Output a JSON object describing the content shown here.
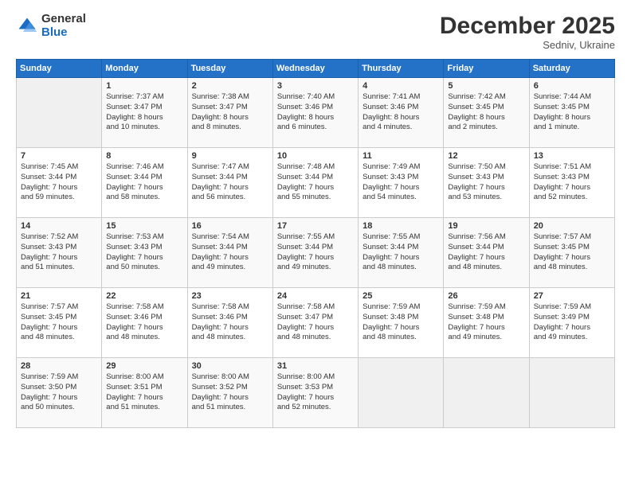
{
  "header": {
    "logo_general": "General",
    "logo_blue": "Blue",
    "month_title": "December 2025",
    "location": "Sedniv, Ukraine"
  },
  "weekdays": [
    "Sunday",
    "Monday",
    "Tuesday",
    "Wednesday",
    "Thursday",
    "Friday",
    "Saturday"
  ],
  "weeks": [
    [
      {
        "day": "",
        "info": ""
      },
      {
        "day": "1",
        "info": "Sunrise: 7:37 AM\nSunset: 3:47 PM\nDaylight: 8 hours\nand 10 minutes."
      },
      {
        "day": "2",
        "info": "Sunrise: 7:38 AM\nSunset: 3:47 PM\nDaylight: 8 hours\nand 8 minutes."
      },
      {
        "day": "3",
        "info": "Sunrise: 7:40 AM\nSunset: 3:46 PM\nDaylight: 8 hours\nand 6 minutes."
      },
      {
        "day": "4",
        "info": "Sunrise: 7:41 AM\nSunset: 3:46 PM\nDaylight: 8 hours\nand 4 minutes."
      },
      {
        "day": "5",
        "info": "Sunrise: 7:42 AM\nSunset: 3:45 PM\nDaylight: 8 hours\nand 2 minutes."
      },
      {
        "day": "6",
        "info": "Sunrise: 7:44 AM\nSunset: 3:45 PM\nDaylight: 8 hours\nand 1 minute."
      }
    ],
    [
      {
        "day": "7",
        "info": "Sunrise: 7:45 AM\nSunset: 3:44 PM\nDaylight: 7 hours\nand 59 minutes."
      },
      {
        "day": "8",
        "info": "Sunrise: 7:46 AM\nSunset: 3:44 PM\nDaylight: 7 hours\nand 58 minutes."
      },
      {
        "day": "9",
        "info": "Sunrise: 7:47 AM\nSunset: 3:44 PM\nDaylight: 7 hours\nand 56 minutes."
      },
      {
        "day": "10",
        "info": "Sunrise: 7:48 AM\nSunset: 3:44 PM\nDaylight: 7 hours\nand 55 minutes."
      },
      {
        "day": "11",
        "info": "Sunrise: 7:49 AM\nSunset: 3:43 PM\nDaylight: 7 hours\nand 54 minutes."
      },
      {
        "day": "12",
        "info": "Sunrise: 7:50 AM\nSunset: 3:43 PM\nDaylight: 7 hours\nand 53 minutes."
      },
      {
        "day": "13",
        "info": "Sunrise: 7:51 AM\nSunset: 3:43 PM\nDaylight: 7 hours\nand 52 minutes."
      }
    ],
    [
      {
        "day": "14",
        "info": "Sunrise: 7:52 AM\nSunset: 3:43 PM\nDaylight: 7 hours\nand 51 minutes."
      },
      {
        "day": "15",
        "info": "Sunrise: 7:53 AM\nSunset: 3:43 PM\nDaylight: 7 hours\nand 50 minutes."
      },
      {
        "day": "16",
        "info": "Sunrise: 7:54 AM\nSunset: 3:44 PM\nDaylight: 7 hours\nand 49 minutes."
      },
      {
        "day": "17",
        "info": "Sunrise: 7:55 AM\nSunset: 3:44 PM\nDaylight: 7 hours\nand 49 minutes."
      },
      {
        "day": "18",
        "info": "Sunrise: 7:55 AM\nSunset: 3:44 PM\nDaylight: 7 hours\nand 48 minutes."
      },
      {
        "day": "19",
        "info": "Sunrise: 7:56 AM\nSunset: 3:44 PM\nDaylight: 7 hours\nand 48 minutes."
      },
      {
        "day": "20",
        "info": "Sunrise: 7:57 AM\nSunset: 3:45 PM\nDaylight: 7 hours\nand 48 minutes."
      }
    ],
    [
      {
        "day": "21",
        "info": "Sunrise: 7:57 AM\nSunset: 3:45 PM\nDaylight: 7 hours\nand 48 minutes."
      },
      {
        "day": "22",
        "info": "Sunrise: 7:58 AM\nSunset: 3:46 PM\nDaylight: 7 hours\nand 48 minutes."
      },
      {
        "day": "23",
        "info": "Sunrise: 7:58 AM\nSunset: 3:46 PM\nDaylight: 7 hours\nand 48 minutes."
      },
      {
        "day": "24",
        "info": "Sunrise: 7:58 AM\nSunset: 3:47 PM\nDaylight: 7 hours\nand 48 minutes."
      },
      {
        "day": "25",
        "info": "Sunrise: 7:59 AM\nSunset: 3:48 PM\nDaylight: 7 hours\nand 48 minutes."
      },
      {
        "day": "26",
        "info": "Sunrise: 7:59 AM\nSunset: 3:48 PM\nDaylight: 7 hours\nand 49 minutes."
      },
      {
        "day": "27",
        "info": "Sunrise: 7:59 AM\nSunset: 3:49 PM\nDaylight: 7 hours\nand 49 minutes."
      }
    ],
    [
      {
        "day": "28",
        "info": "Sunrise: 7:59 AM\nSunset: 3:50 PM\nDaylight: 7 hours\nand 50 minutes."
      },
      {
        "day": "29",
        "info": "Sunrise: 8:00 AM\nSunset: 3:51 PM\nDaylight: 7 hours\nand 51 minutes."
      },
      {
        "day": "30",
        "info": "Sunrise: 8:00 AM\nSunset: 3:52 PM\nDaylight: 7 hours\nand 51 minutes."
      },
      {
        "day": "31",
        "info": "Sunrise: 8:00 AM\nSunset: 3:53 PM\nDaylight: 7 hours\nand 52 minutes."
      },
      {
        "day": "",
        "info": ""
      },
      {
        "day": "",
        "info": ""
      },
      {
        "day": "",
        "info": ""
      }
    ]
  ]
}
